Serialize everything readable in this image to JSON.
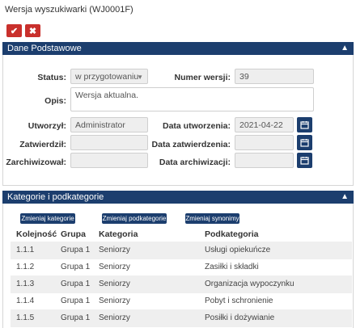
{
  "page": {
    "title": "Wersja wyszukiwarki (WJ0001F)"
  },
  "actions": {
    "confirm_icon": "check-icon",
    "cancel_icon": "close-icon",
    "confirm_glyph": "✔",
    "cancel_glyph": "✖"
  },
  "panel1": {
    "title": "Dane Podstawowe",
    "status_label": "Status:",
    "status_value": "w przygotowaniu",
    "numer_label": "Numer wersji:",
    "numer_value": "39",
    "opis_label": "Opis:",
    "opis_value": "Wersja aktualna.",
    "utworzyl_label": "Utworzył:",
    "utworzyl_value": "Administrator",
    "data_utw_label": "Data utworzenia:",
    "data_utw_value": "2021-04-22",
    "zatwierdzil_label": "Zatwierdził:",
    "zatwierdzil_value": "",
    "data_zatw_label": "Data zatwierdzenia:",
    "data_zatw_value": "",
    "zarchiwizowal_label": "Zarchiwizował:",
    "zarchiwizowal_value": "",
    "data_arch_label": "Data archiwizacji:",
    "data_arch_value": ""
  },
  "panel2": {
    "title": "Kategorie i podkategorie",
    "buttons": [
      "Zmieniaj kategorie",
      "Zmieniaj podkategorie",
      "Zmieniaj synonimy"
    ],
    "columns": [
      "Kolejność",
      "Grupa",
      "Kategoria",
      "Podkategoria"
    ],
    "rows": [
      [
        "1.1.1",
        "Grupa 1",
        "Seniorzy",
        "Usługi opiekuńcze"
      ],
      [
        "1.1.2",
        "Grupa 1",
        "Seniorzy",
        "Zasiłki i składki"
      ],
      [
        "1.1.3",
        "Grupa 1",
        "Seniorzy",
        "Organizacja wypoczynku"
      ],
      [
        "1.1.4",
        "Grupa 1",
        "Seniorzy",
        "Pobyt i schronienie"
      ],
      [
        "1.1.5",
        "Grupa 1",
        "Seniorzy",
        "Posiłki i dożywianie"
      ]
    ]
  },
  "colors": {
    "header": "#1c3e6e",
    "danger": "#c9302c",
    "row_alt": "#efefef"
  }
}
